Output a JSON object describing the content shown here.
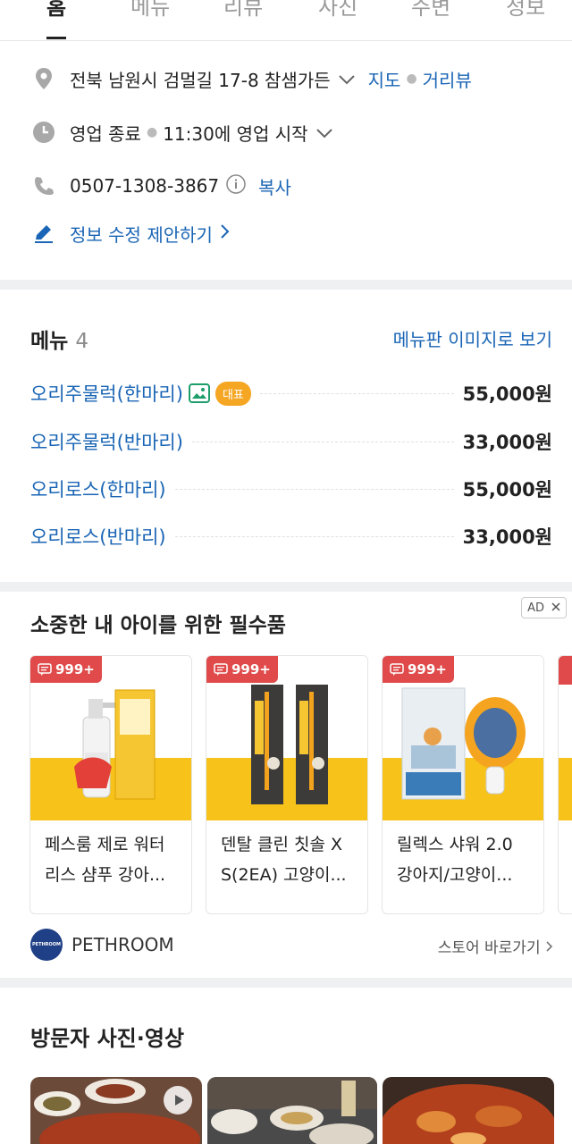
{
  "tabs": [
    "홈",
    "메뉴",
    "리뷰",
    "사진",
    "주변",
    "정보"
  ],
  "info": {
    "address": "전북 남원시 검멀길 17-8 참샘가든",
    "map_label": "지도",
    "street_view_label": "거리뷰",
    "status": "영업 종료",
    "hours": "11:30에 영업 시작",
    "phone": "0507-1308-3867",
    "copy_label": "복사",
    "suggest_edit": "정보 수정 제안하기"
  },
  "menu": {
    "title": "메뉴",
    "count": "4",
    "image_link": "메뉴판 이미지로 보기",
    "representative_badge": "대표",
    "items": [
      {
        "name": "오리주물럭(한마리)",
        "price": "55,000원"
      },
      {
        "name": "오리주물럭(반마리)",
        "price": "33,000원"
      },
      {
        "name": "오리로스(한마리)",
        "price": "55,000원"
      },
      {
        "name": "오리로스(반마리)",
        "price": "33,000원"
      }
    ]
  },
  "ad": {
    "title": "소중한 내 아이를 위한 필수품",
    "badge": "AD",
    "products": [
      {
        "badge": "999+",
        "line1": "페스룸 제로 워터",
        "line2": "리스 샴푸 강아..."
      },
      {
        "badge": "999+",
        "line1": "덴탈 클린 칫솔 X",
        "line2": "S(2EA) 고양이..."
      },
      {
        "badge": "999+",
        "line1": "릴렉스 샤워 2.0",
        "line2": "강아지/고양이..."
      }
    ],
    "brand": "PETHROOM",
    "brand_logo_text": "PETHROOM",
    "store_link": "스토어 바로가기"
  },
  "visitor": {
    "title": "방문자 사진·영상"
  },
  "colors": {
    "link": "#1a65b5",
    "badge_red": "#e04a4a",
    "badge_orange": "#f5a623",
    "product_yellow": "#f7c31b"
  }
}
